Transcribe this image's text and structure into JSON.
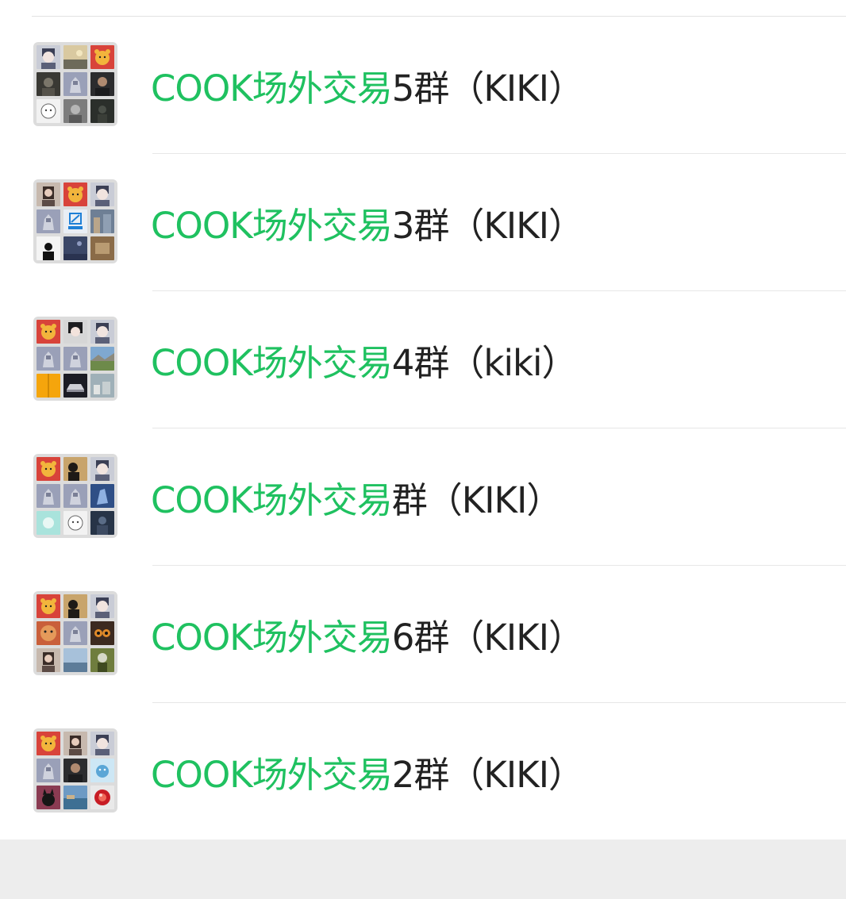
{
  "search_results": {
    "groups": [
      {
        "keyword": "COOK场外交易",
        "suffix": "5群（KIKI）",
        "avatar_tiles": [
          "anime-boy",
          "landscape-sunset",
          "cartoon-bear",
          "dark-portrait",
          "armor-figure",
          "man-portrait",
          "anime-girl-sketch",
          "gray-portrait",
          "dark-figure"
        ]
      },
      {
        "keyword": "COOK场外交易",
        "suffix": "3群（KIKI）",
        "avatar_tiles": [
          "woman-portrait",
          "cartoon-bear",
          "anime-boy",
          "armor-figure",
          "logo-tile",
          "blue-street",
          "silhouette",
          "blue-night",
          "brown-room"
        ]
      },
      {
        "keyword": "COOK场外交易",
        "suffix": "4群（kiki）",
        "avatar_tiles": [
          "cartoon-bear",
          "anime-dark-hair",
          "anime-boy",
          "armor-figure",
          "armor-figure",
          "landscape-sky",
          "yellow-block",
          "car-dark",
          "mountain-town"
        ]
      },
      {
        "keyword": "COOK场外交易",
        "suffix": "群（KIKI）",
        "avatar_tiles": [
          "cartoon-bear",
          "sunset-silhouette",
          "anime-boy",
          "armor-figure",
          "armor-figure",
          "blue-creature",
          "mint-abstract",
          "anime-girl-sketch",
          "dark-blue-figure"
        ]
      },
      {
        "keyword": "COOK场外交易",
        "suffix": "6群（KIKI）",
        "avatar_tiles": [
          "cartoon-bear",
          "sunset-silhouette",
          "anime-boy",
          "tiger-face",
          "armor-figure",
          "owl-face",
          "woman-portrait",
          "lake-sky",
          "green-figure"
        ]
      },
      {
        "keyword": "COOK场外交易",
        "suffix": "2群（KIKI）",
        "avatar_tiles": [
          "cartoon-bear",
          "woman-portrait",
          "anime-boy",
          "armor-figure",
          "man-portrait",
          "cute-blue-creature",
          "black-cat",
          "blue-lake",
          "red-orb"
        ]
      }
    ]
  },
  "colors": {
    "highlight": "#1fc160",
    "text": "#222222",
    "divider": "#e7e7e7",
    "footer_bg": "#ededed"
  }
}
